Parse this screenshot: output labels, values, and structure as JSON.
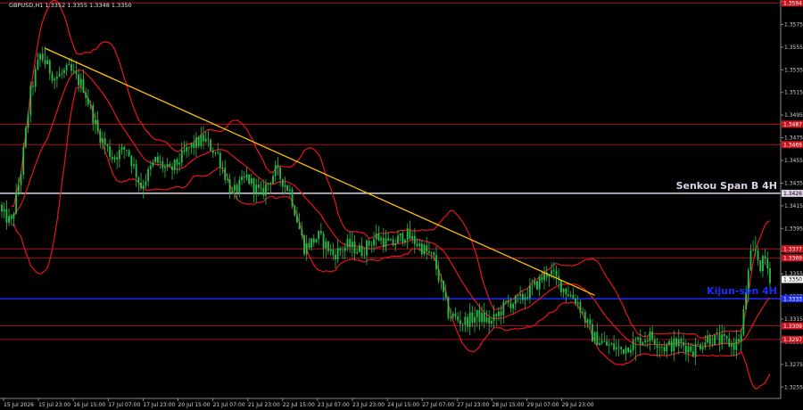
{
  "header": {
    "symbol_text": "GBPUSD,H1  1.3352 1.3355 1.3348 1.3350"
  },
  "colors": {
    "background": "#000000",
    "candle": "#22c04a",
    "bands": "#e8141c",
    "level_red": "#c8141c",
    "senkou": "#dcd3e6",
    "kijun": "#1a2cff",
    "trendline": "#ffc400",
    "axis": "#8a8a8a",
    "text": "#d0d0d0"
  },
  "chart_data": {
    "type": "candlestick",
    "symbol": "GBPUSD",
    "timeframe": "H1",
    "ylim": [
      1.3245,
      1.3595
    ],
    "y_ticks": [
      "1.3595",
      "1.3575",
      "1.3555",
      "1.3535",
      "1.3515",
      "1.3495",
      "1.3475",
      "1.3455",
      "1.3435",
      "1.3415",
      "1.3395",
      "1.3375",
      "1.3355",
      "1.3335",
      "1.3315",
      "1.3295",
      "1.3275",
      "1.3255"
    ],
    "x_ticks": [
      "15 Jul 2026",
      "15 Jul 23:00",
      "16 Jul 15:00",
      "17 Jul 07:00",
      "17 Jul 23:00",
      "20 Jul 15:00",
      "21 Jul 07:00",
      "21 Jul 23:00",
      "22 Jul 15:00",
      "23 Jul 07:00",
      "23 Jul 23:00",
      "24 Jul 15:00",
      "27 Jul 07:00",
      "27 Jul 23:00",
      "28 Jul 15:00",
      "29 Jul 07:00",
      "29 Jul 23:00"
    ],
    "close_path": [
      {
        "i": 0,
        "v": 1.3408
      },
      {
        "i": 4,
        "v": 1.34
      },
      {
        "i": 8,
        "v": 1.3445
      },
      {
        "i": 12,
        "v": 1.3515
      },
      {
        "i": 16,
        "v": 1.3548
      },
      {
        "i": 22,
        "v": 1.3528
      },
      {
        "i": 28,
        "v": 1.3535
      },
      {
        "i": 34,
        "v": 1.352
      },
      {
        "i": 40,
        "v": 1.348
      },
      {
        "i": 46,
        "v": 1.3458
      },
      {
        "i": 52,
        "v": 1.3466
      },
      {
        "i": 58,
        "v": 1.3432
      },
      {
        "i": 64,
        "v": 1.3455
      },
      {
        "i": 70,
        "v": 1.3445
      },
      {
        "i": 78,
        "v": 1.3466
      },
      {
        "i": 84,
        "v": 1.3474
      },
      {
        "i": 90,
        "v": 1.346
      },
      {
        "i": 96,
        "v": 1.3425
      },
      {
        "i": 102,
        "v": 1.344
      },
      {
        "i": 108,
        "v": 1.3425
      },
      {
        "i": 114,
        "v": 1.3446
      },
      {
        "i": 120,
        "v": 1.3428
      },
      {
        "i": 126,
        "v": 1.3378
      },
      {
        "i": 132,
        "v": 1.3388
      },
      {
        "i": 138,
        "v": 1.3372
      },
      {
        "i": 144,
        "v": 1.338
      },
      {
        "i": 150,
        "v": 1.3375
      },
      {
        "i": 156,
        "v": 1.3388
      },
      {
        "i": 162,
        "v": 1.338
      },
      {
        "i": 168,
        "v": 1.339
      },
      {
        "i": 174,
        "v": 1.338
      },
      {
        "i": 180,
        "v": 1.3368
      },
      {
        "i": 186,
        "v": 1.332
      },
      {
        "i": 192,
        "v": 1.3312
      },
      {
        "i": 198,
        "v": 1.3318
      },
      {
        "i": 204,
        "v": 1.3312
      },
      {
        "i": 210,
        "v": 1.3328
      },
      {
        "i": 216,
        "v": 1.3332
      },
      {
        "i": 222,
        "v": 1.3344
      },
      {
        "i": 228,
        "v": 1.3358
      },
      {
        "i": 234,
        "v": 1.3342
      },
      {
        "i": 240,
        "v": 1.333
      },
      {
        "i": 246,
        "v": 1.33
      },
      {
        "i": 252,
        "v": 1.3292
      },
      {
        "i": 258,
        "v": 1.3288
      },
      {
        "i": 264,
        "v": 1.3295
      },
      {
        "i": 270,
        "v": 1.33
      },
      {
        "i": 276,
        "v": 1.329
      },
      {
        "i": 282,
        "v": 1.3294
      },
      {
        "i": 288,
        "v": 1.3288
      },
      {
        "i": 294,
        "v": 1.3298
      },
      {
        "i": 300,
        "v": 1.3296
      },
      {
        "i": 305,
        "v": 1.3292
      },
      {
        "i": 308,
        "v": 1.33
      },
      {
        "i": 310,
        "v": 1.334
      },
      {
        "i": 312,
        "v": 1.337
      },
      {
        "i": 314,
        "v": 1.3375
      },
      {
        "i": 316,
        "v": 1.3362
      },
      {
        "i": 318,
        "v": 1.3368
      },
      {
        "i": 320,
        "v": 1.3352
      }
    ],
    "levels": [
      {
        "price": 1.3594,
        "label": "1.3594",
        "kind": "red"
      },
      {
        "price": 1.3487,
        "label": "1.3487",
        "kind": "red"
      },
      {
        "price": 1.3469,
        "label": "1.3469",
        "kind": "red"
      },
      {
        "price": 1.3426,
        "label": "1.3426",
        "kind": "senkou",
        "name": "Senkou Span B 4H"
      },
      {
        "price": 1.3377,
        "label": "1.3377",
        "kind": "red"
      },
      {
        "price": 1.3369,
        "label": "1.3369",
        "kind": "red"
      },
      {
        "price": 1.3333,
        "label": "1.3333",
        "kind": "kijun",
        "name": "Kijun-sen 4H"
      },
      {
        "price": 1.3309,
        "label": "1.3309",
        "kind": "red"
      },
      {
        "price": 1.3297,
        "label": "1.3297",
        "kind": "red"
      }
    ],
    "current_price": {
      "price": 1.335,
      "label": "1.3350"
    },
    "trendline": [
      {
        "i": 18,
        "v": 1.3554
      },
      {
        "i": 247,
        "v": 1.3336
      }
    ],
    "indicator": "Bollinger Bands"
  }
}
